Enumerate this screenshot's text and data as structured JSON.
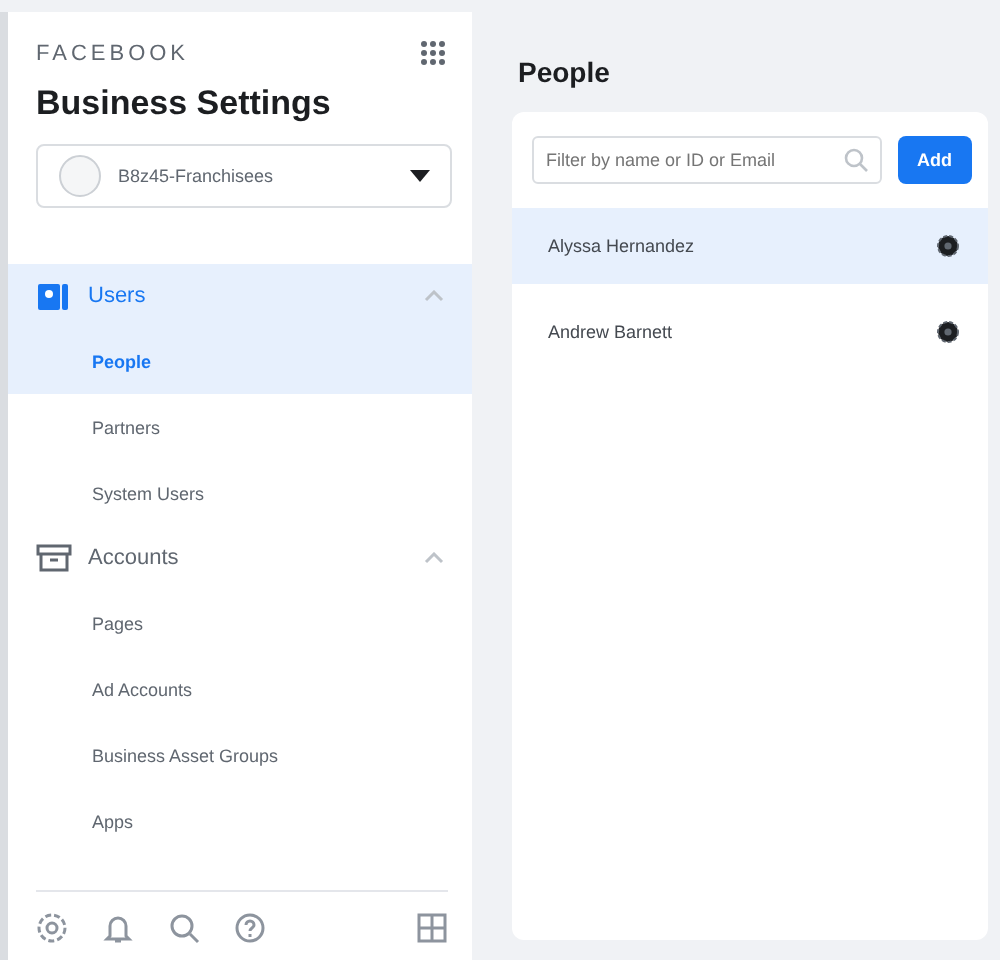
{
  "sidebar": {
    "brand": "FACEBOOK",
    "title": "Business Settings",
    "account": "B8z45-Franchisees",
    "sections": [
      {
        "label": "Users",
        "kind": "users",
        "expanded": true,
        "selected": true,
        "items": [
          {
            "label": "People",
            "selected": true
          },
          {
            "label": "Partners",
            "selected": false
          },
          {
            "label": "System Users",
            "selected": false
          }
        ]
      },
      {
        "label": "Accounts",
        "kind": "accounts",
        "expanded": true,
        "selected": false,
        "items": [
          {
            "label": "Pages",
            "selected": false
          },
          {
            "label": "Ad Accounts",
            "selected": false
          },
          {
            "label": "Business Asset Groups",
            "selected": false
          },
          {
            "label": "Apps",
            "selected": false
          }
        ]
      }
    ]
  },
  "main": {
    "title": "People",
    "filter": {
      "placeholder": "Filter by name or ID or Email"
    },
    "add_button": "Add",
    "people": [
      {
        "name": "Alyssa Hernandez",
        "selected": true
      },
      {
        "name": "Andrew Barnett",
        "selected": false
      }
    ]
  }
}
